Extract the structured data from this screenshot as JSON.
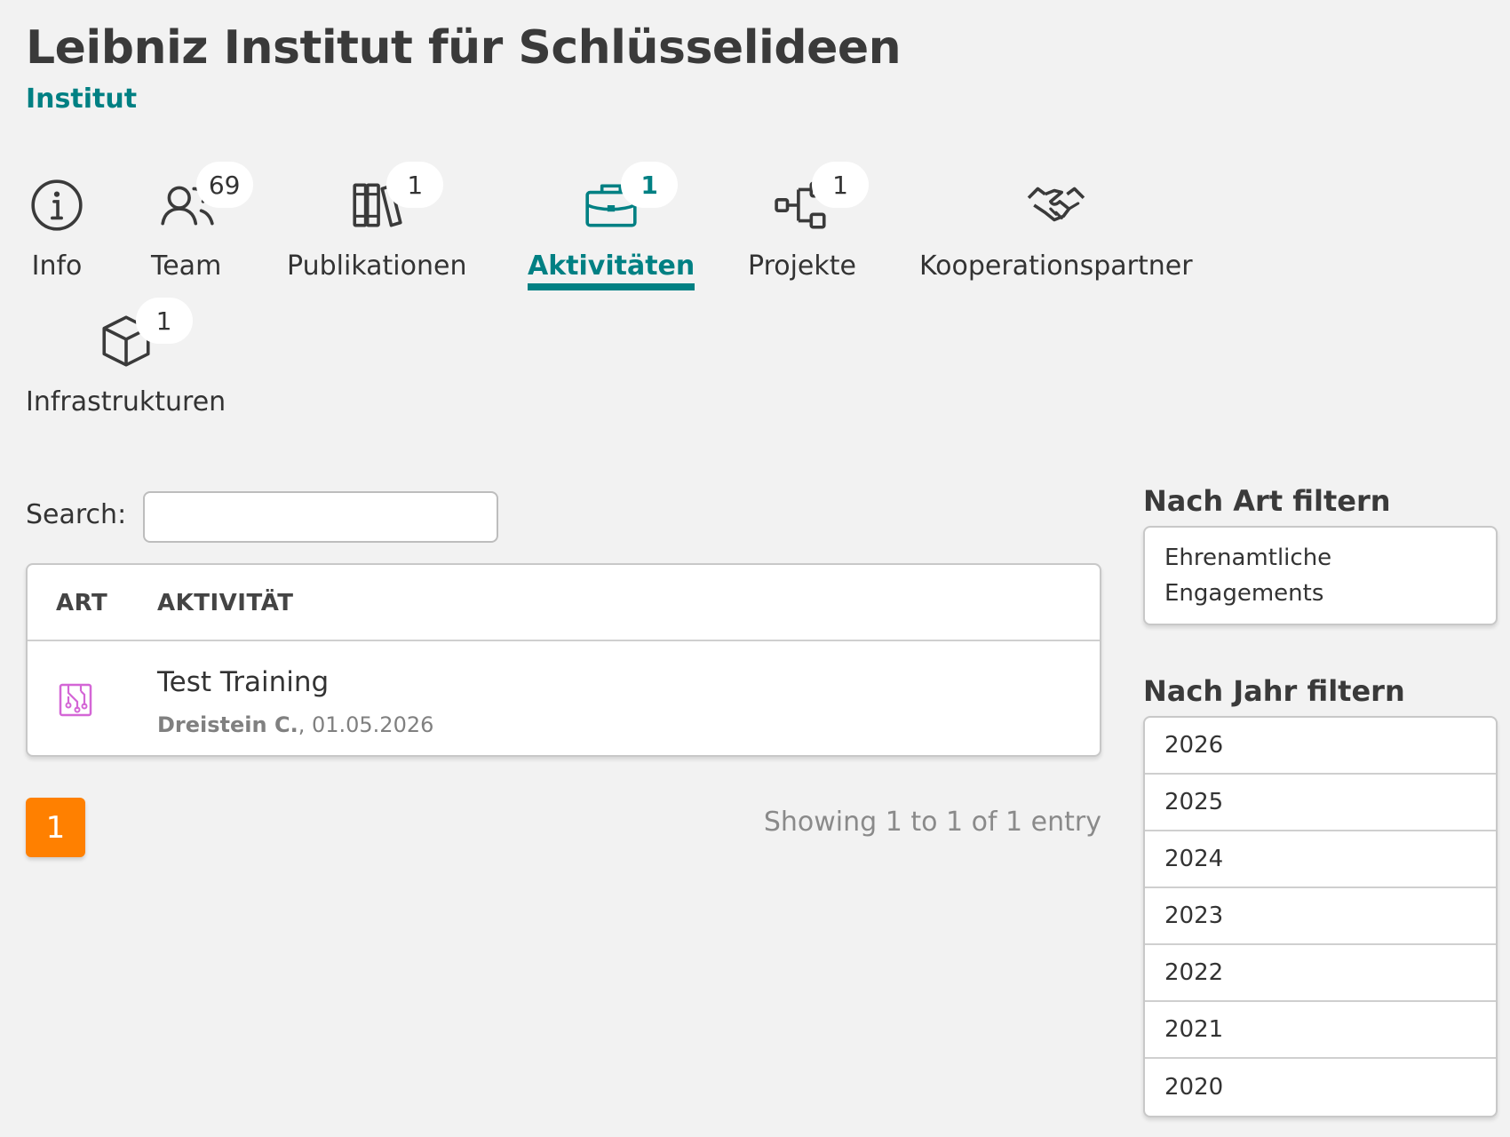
{
  "header": {
    "title": "Leibniz Institut für Schlüsselideen",
    "subtitle": "Institut"
  },
  "tabs": [
    {
      "label": "Info",
      "icon": "info-icon",
      "badge": ""
    },
    {
      "label": "Team",
      "icon": "users-icon",
      "badge": "69"
    },
    {
      "label": "Publikationen",
      "icon": "books-icon",
      "badge": "1"
    },
    {
      "label": "Aktivitäten",
      "icon": "briefcase-icon",
      "badge": "1",
      "active": true
    },
    {
      "label": "Projekte",
      "icon": "tree-structure-icon",
      "badge": "1"
    },
    {
      "label": "Kooperationspartner",
      "icon": "handshake-icon",
      "badge": ""
    },
    {
      "label": "Infrastrukturen",
      "icon": "cube-icon",
      "badge": "1"
    }
  ],
  "search": {
    "label": "Search:",
    "value": "",
    "placeholder": ""
  },
  "table": {
    "headers": [
      "ART",
      "AKTIVITÄT"
    ],
    "rows": [
      {
        "type_icon": "circuit-board-icon",
        "type_color": "#d466d6",
        "title": "Test Training",
        "author": "Dreistein C.",
        "date_sep": ", ",
        "date": "01.05.2026"
      }
    ]
  },
  "pagination": {
    "current": "1",
    "info": "Showing 1 to 1 of 1 entry"
  },
  "filters": {
    "art": {
      "heading": "Nach Art filtern",
      "items": [
        "Ehrenamtliche Engagements"
      ]
    },
    "year": {
      "heading": "Nach Jahr filtern",
      "items": [
        "2026",
        "2025",
        "2024",
        "2023",
        "2022",
        "2021",
        "2020"
      ]
    }
  },
  "colors": {
    "accent": "#008083",
    "page_button": "#ff8000",
    "background": "#f2f2f2"
  }
}
